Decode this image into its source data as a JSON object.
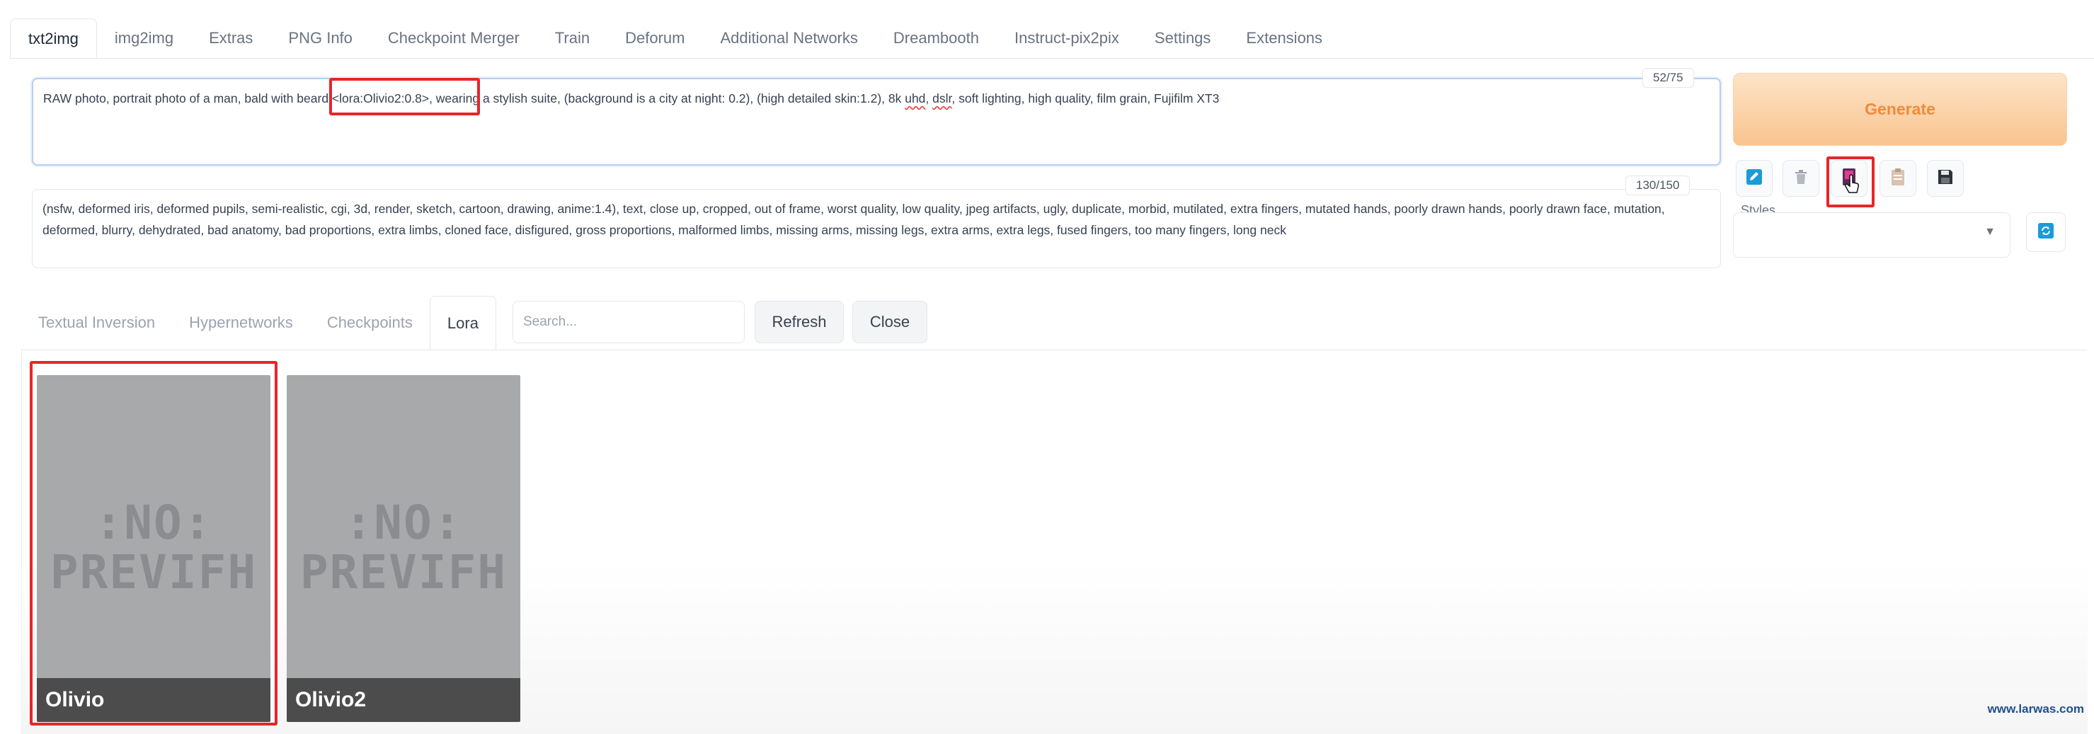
{
  "top_tabs": [
    "txt2img",
    "img2img",
    "Extras",
    "PNG Info",
    "Checkpoint Merger",
    "Train",
    "Deforum",
    "Additional Networks",
    "Dreambooth",
    "Instruct-pix2pix",
    "Settings",
    "Extensions"
  ],
  "prompt": {
    "before": "RAW photo, portrait photo of a man, bald with beard <lora:Olivio2:0.8>, wearing a stylish suite, (background is a city at night: 0.2), (high detailed skin:1.2), 8k ",
    "uhd": "uhd",
    "mid": ", ",
    "dslr": "dslr",
    "after": ", soft lighting, high quality, film grain, Fujifilm XT3",
    "counter": "52/75"
  },
  "negative_prompt": {
    "text": "(nsfw, deformed iris, deformed pupils, semi-realistic, cgi, 3d, render, sketch, cartoon, drawing, anime:1.4), text, close up, cropped, out of frame, worst quality, low quality, jpeg artifacts, ugly, duplicate, morbid, mutilated, extra fingers, mutated hands, poorly drawn hands, poorly drawn face, mutation, deformed, blurry, dehydrated, bad anatomy, bad proportions, extra limbs, cloned face, disfigured, gross proportions, malformed limbs, missing arms, missing legs, extra arms, extra legs, fused fingers, too many fingers, long neck",
    "counter": "130/150"
  },
  "generate_label": "Generate",
  "styles": {
    "label": "Styles",
    "value": ""
  },
  "extra_networks": {
    "tabs": [
      "Textual Inversion",
      "Hypernetworks",
      "Checkpoints",
      "Lora"
    ],
    "search_placeholder": "Search...",
    "refresh_label": "Refresh",
    "close_label": "Close",
    "cards": [
      {
        "name": "Olivio",
        "preview_line1": ":NO:",
        "preview_line2": "PREVIFH"
      },
      {
        "name": "Olivio2",
        "preview_line1": ":NO:",
        "preview_line2": "PREVIFH"
      }
    ]
  },
  "icons": {
    "style_apply": "pencil-square-icon",
    "trash": "trash-icon",
    "extra_networks": "card-icon",
    "clipboard": "clipboard-icon",
    "save": "floppy-disk-icon",
    "refresh_styles": "refresh-icon"
  },
  "colors": {
    "generate_text": "#f08a3c",
    "annotation_red": "#e8252a",
    "accent_blue": "#1b9bd8"
  },
  "watermark": "www.larwas.com"
}
